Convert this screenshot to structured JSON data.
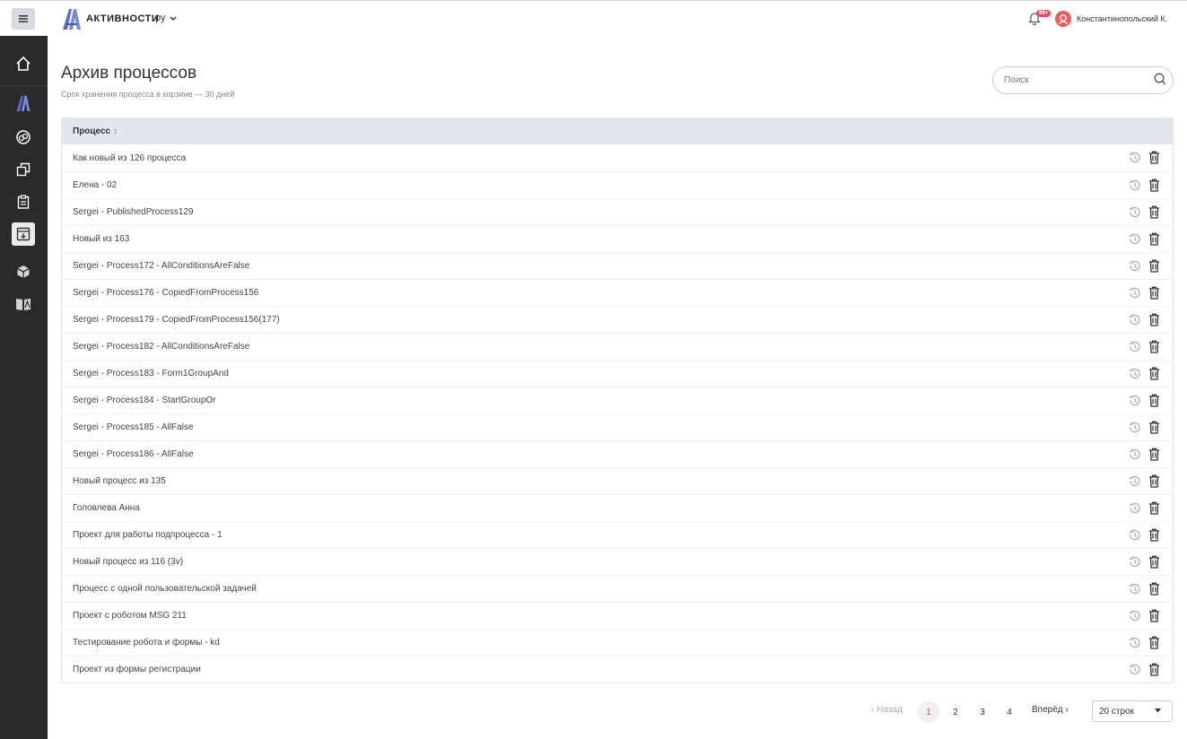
{
  "app": {
    "title": "АКТИВНОСТИ",
    "lang": "ру",
    "notif_badge": "99+",
    "user_name": "Константинопольский К."
  },
  "sidebar": {
    "items": [
      {
        "icon": "home-icon"
      },
      {
        "icon": "activities-logo-icon"
      },
      {
        "icon": "link-icon"
      },
      {
        "icon": "copy-icon"
      },
      {
        "icon": "clipboard-icon"
      },
      {
        "icon": "archive-icon",
        "active": true
      },
      {
        "icon": "cube-icon"
      },
      {
        "icon": "book-icon"
      }
    ]
  },
  "page": {
    "title": "Архив процессов",
    "subtitle": "Срок хранения процесса в корзине — 30 дней",
    "search_placeholder": "Поиск"
  },
  "table": {
    "column": "Процесс",
    "rows": [
      "Как новый из 126 процесса",
      "Елена - 02",
      "Sergei - PublishedProcess129",
      "Новый из 163",
      "Sergei - Process172 - AllConditionsAreFalse",
      "Sergei - Process176 - CopiedFromProcess156",
      "Sergei - Process179 - CopiedFromProcess156(177)",
      "Sergei - Process182 - AllConditionsAreFalse",
      "Sergei - Process183 - Form1GroupAnd",
      "Sergei - Process184 - StartGroupOr",
      "Sergei - Process185 - AllFalse",
      "Sergei - Process186 - AllFalse",
      "Новый процесс из 135",
      "Головлева Анна",
      "Проект для работы подпроцесса - 1",
      "Новый процесс из 116 (3v)",
      "Процесс с одной пользовательской задачей",
      "Проект с роботом MSG 211",
      "Тестирование робота и формы - kd",
      "Проект из формы регистрации"
    ]
  },
  "pagination": {
    "prev": "‹ Назад",
    "pages": [
      "1",
      "2",
      "3",
      "4"
    ],
    "current": "1",
    "next": "Вперёд ›",
    "rows_per_page": "20 строк"
  },
  "colors": {
    "sidebar_bg": "#2a2a2c",
    "header_row_bg": "#e2e6ee",
    "accent_red": "#e0455a",
    "brand_blue": "#5b6bc9"
  }
}
